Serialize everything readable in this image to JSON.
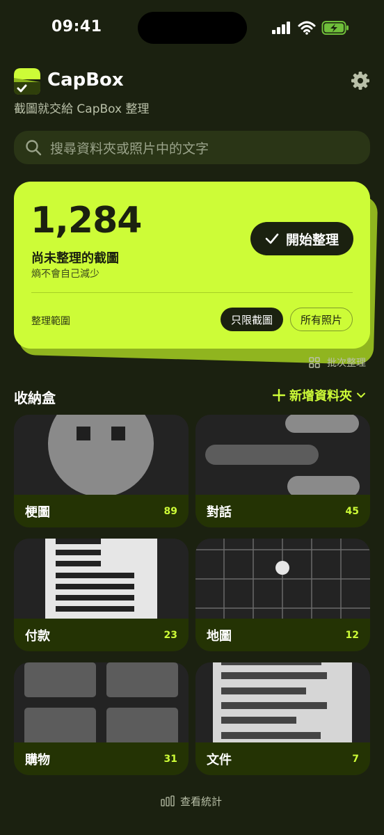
{
  "status_bar": {
    "time": "09:41"
  },
  "header": {
    "app_name": "CapBox",
    "subtitle": "截圖就交給 CapBox 整理",
    "icons": {
      "logo": "capbox-logo-icon",
      "settings": "gear-icon"
    }
  },
  "search": {
    "placeholder": "搜尋資料夾或照片中的文字",
    "icon": "search-icon"
  },
  "hero": {
    "count": "1,284",
    "count_label": "尚未整理的截圖",
    "count_note": "熵不會自己減少",
    "start_button": "開始整理",
    "scope_label": "整理範圍",
    "scope_options": [
      "只限截圖",
      "所有照片"
    ],
    "scope_selected": "只限截圖",
    "batch_label": "批次整理"
  },
  "inbox": {
    "title": "收納盒",
    "add_folder": "新增資料夾",
    "folders": [
      {
        "name": "梗圖",
        "count": "89"
      },
      {
        "name": "對話",
        "count": "45"
      },
      {
        "name": "付款",
        "count": "23"
      },
      {
        "name": "地圖",
        "count": "12"
      },
      {
        "name": "購物",
        "count": "31"
      },
      {
        "name": "文件",
        "count": "7"
      }
    ]
  },
  "footer": {
    "stats_label": "查看統計"
  },
  "colors": {
    "background": "#1b2110",
    "accent": "#cdfc37",
    "tile_footer": "#243304",
    "search_bg": "#2a3516"
  }
}
